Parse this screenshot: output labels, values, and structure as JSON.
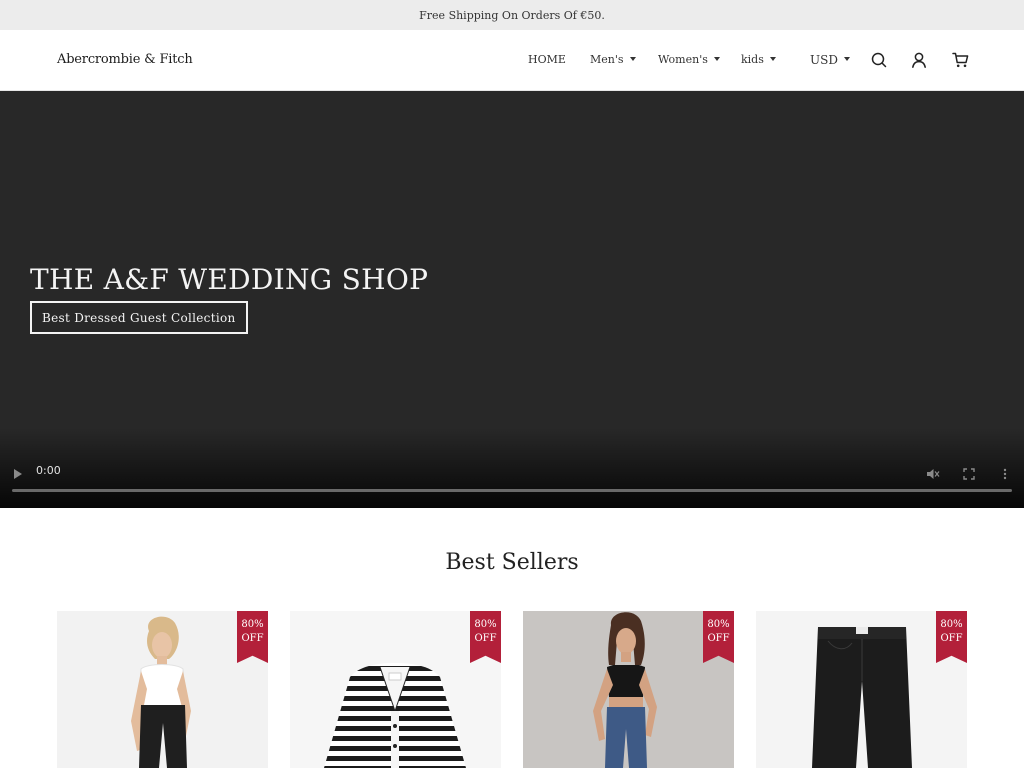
{
  "announcement": "Free Shipping On Orders Of €50.",
  "header": {
    "logo": "Abercrombie & Fitch",
    "nav": [
      {
        "label": "HOME"
      },
      {
        "label": "Men's"
      },
      {
        "label": "Women's"
      },
      {
        "label": "kids"
      }
    ],
    "currency": "USD",
    "icons": [
      "search-icon",
      "account-icon",
      "cart-icon"
    ]
  },
  "hero": {
    "title": "THE A&F WEDDING SHOP",
    "button": "Best Dressed Guest Collection",
    "video": {
      "time": "0:00",
      "progress": 0
    }
  },
  "best_sellers": {
    "title": "Best Sellers",
    "products": [
      {
        "badge_line1": "80%",
        "badge_line2": "OFF",
        "image": "woman-white-tee-black-jeans"
      },
      {
        "badge_line1": "80%",
        "badge_line2": "OFF",
        "image": "striped-cardigan"
      },
      {
        "badge_line1": "80%",
        "badge_line2": "OFF",
        "image": "woman-black-crop-top-blue-jeans"
      },
      {
        "badge_line1": "80%",
        "badge_line2": "OFF",
        "image": "black-jeans"
      }
    ]
  },
  "colors": {
    "announcement_bg": "#ececec",
    "hero_bg": "#282828",
    "badge": "#b3203a"
  }
}
